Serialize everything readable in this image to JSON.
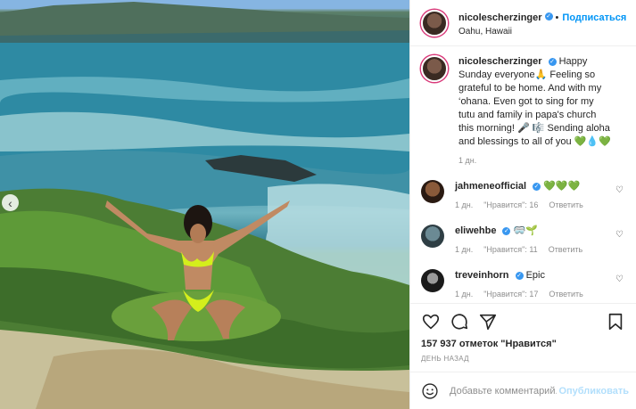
{
  "post": {
    "author": "nicolescherzinger",
    "follow_label": "Подписаться",
    "location": "Oahu, Hawaii",
    "caption": {
      "username": "nicolescherzinger",
      "text": "Happy Sunday everyone🙏 Feeling so grateful to be home. And with my ‘ohana. Even got to sing for my tutu and family in papa's church this morning! 🎤 🎼 Sending aloha and blessings to all of you 💚💧💚",
      "time": "1 дн."
    },
    "comments": [
      {
        "username": "jahmeneofficial",
        "text": "💚💚💚",
        "time": "1 дн.",
        "likes": "\"Нравится\": 16",
        "reply": "Ответить"
      },
      {
        "username": "eliwehbe",
        "text": "🥽🌱",
        "time": "1 дн.",
        "likes": "\"Нравится\": 11",
        "reply": "Ответить"
      },
      {
        "username": "treveinhorn",
        "text": "Epic",
        "time": "1 дн.",
        "likes": "\"Нравится\": 17",
        "reply": "Ответить"
      }
    ],
    "likes_text": "157 937 отметок \"Нравится\"",
    "date_text": "ДЕНЬ НАЗАД",
    "comment_placeholder": "Добавьте комментарий...",
    "publish_label": "Опубликовать"
  },
  "colors": {
    "link": "#0095f6",
    "verified": "#3897f0",
    "publish_disabled": "#b2dffc",
    "muted": "#8e8e8e"
  },
  "icons": [
    "chevron-left-icon",
    "verified-icon",
    "heart-icon",
    "comment-icon",
    "share-icon",
    "bookmark-icon",
    "emoji-icon"
  ]
}
